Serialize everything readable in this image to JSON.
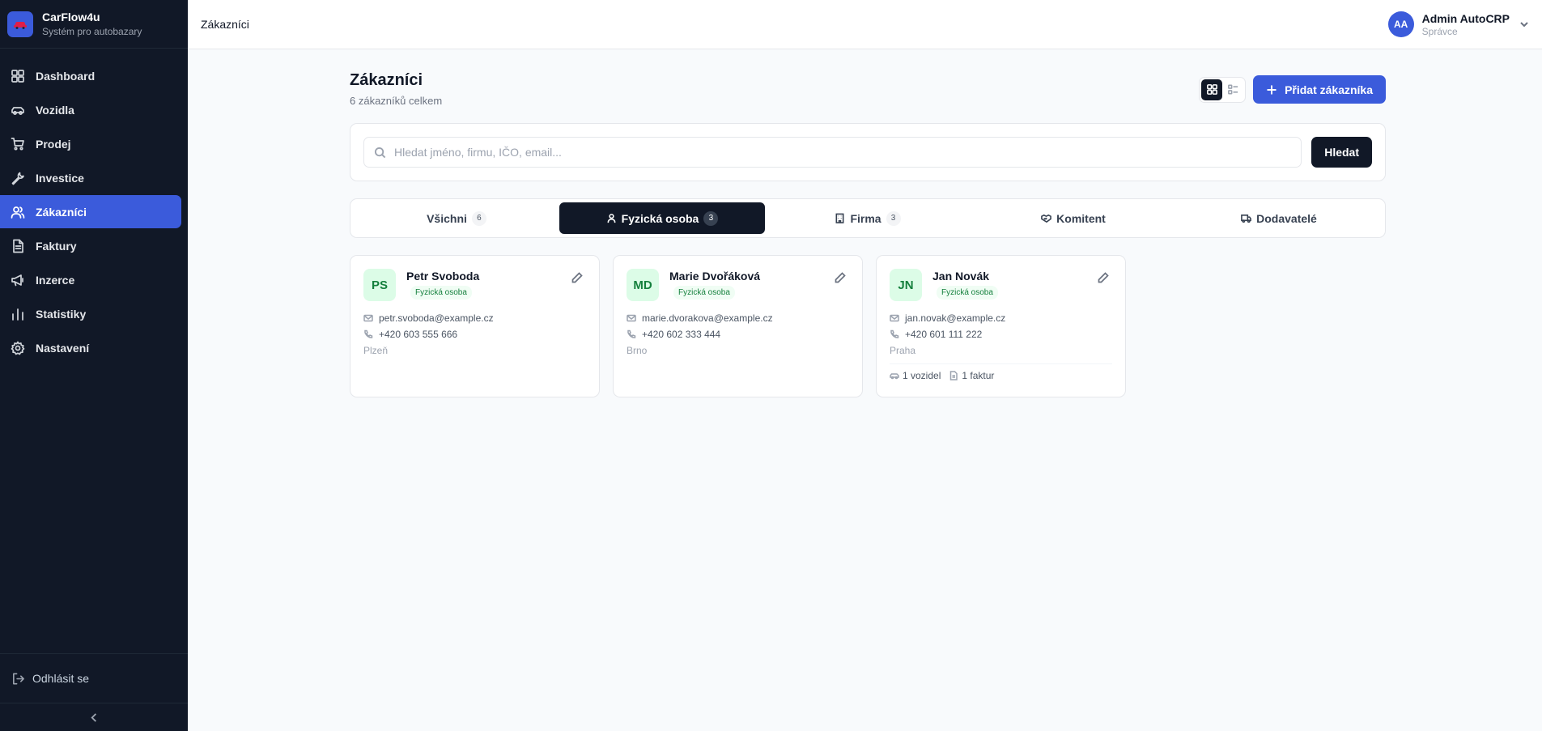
{
  "app": {
    "name": "CarFlow4u",
    "subtitle": "Systém pro autobazary"
  },
  "sidebar": {
    "items": [
      {
        "label": "Dashboard",
        "icon": "dashboard-icon"
      },
      {
        "label": "Vozidla",
        "icon": "car-icon"
      },
      {
        "label": "Prodej",
        "icon": "cart-icon"
      },
      {
        "label": "Investice",
        "icon": "wrench-icon"
      },
      {
        "label": "Zákazníci",
        "icon": "users-icon",
        "active": true
      },
      {
        "label": "Faktury",
        "icon": "document-icon"
      },
      {
        "label": "Inzerce",
        "icon": "megaphone-icon"
      },
      {
        "label": "Statistiky",
        "icon": "bar-chart-icon"
      },
      {
        "label": "Nastavení",
        "icon": "gear-icon"
      }
    ],
    "logout_label": "Odhlásit se"
  },
  "topbar": {
    "title": "Zákazníci"
  },
  "user": {
    "initials": "AA",
    "name": "Admin AutoCRP",
    "role": "Správce"
  },
  "page": {
    "title": "Zákazníci",
    "subtitle": "6 zákazníků celkem",
    "add_button": "Přidat zákazníka"
  },
  "search": {
    "placeholder": "Hledat jméno, firmu, IČO, email...",
    "value": "",
    "button": "Hledat"
  },
  "tabs": [
    {
      "label": "Všichni",
      "count": "6"
    },
    {
      "label": "Fyzická osoba",
      "count": "3",
      "active": true
    },
    {
      "label": "Firma",
      "count": "3"
    },
    {
      "label": "Komitent"
    },
    {
      "label": "Dodavatelé"
    }
  ],
  "customers": [
    {
      "initials": "PS",
      "name": "Petr Svoboda",
      "type": "Fyzická osoba",
      "email": "petr.svoboda@example.cz",
      "phone": "+420 603 555 666",
      "city": "Plzeň"
    },
    {
      "initials": "MD",
      "name": "Marie Dvořáková",
      "type": "Fyzická osoba",
      "email": "marie.dvorakova@example.cz",
      "phone": "+420 602 333 444",
      "city": "Brno"
    },
    {
      "initials": "JN",
      "name": "Jan Novák",
      "type": "Fyzická osoba",
      "email": "jan.novak@example.cz",
      "phone": "+420 601 111 222",
      "city": "Praha",
      "vehicles": "1 vozidel",
      "invoices": "1 faktur"
    }
  ],
  "colors": {
    "accent": "#3b5bdb",
    "sidebar_bg": "#111827",
    "badge_green": "#15803d"
  }
}
